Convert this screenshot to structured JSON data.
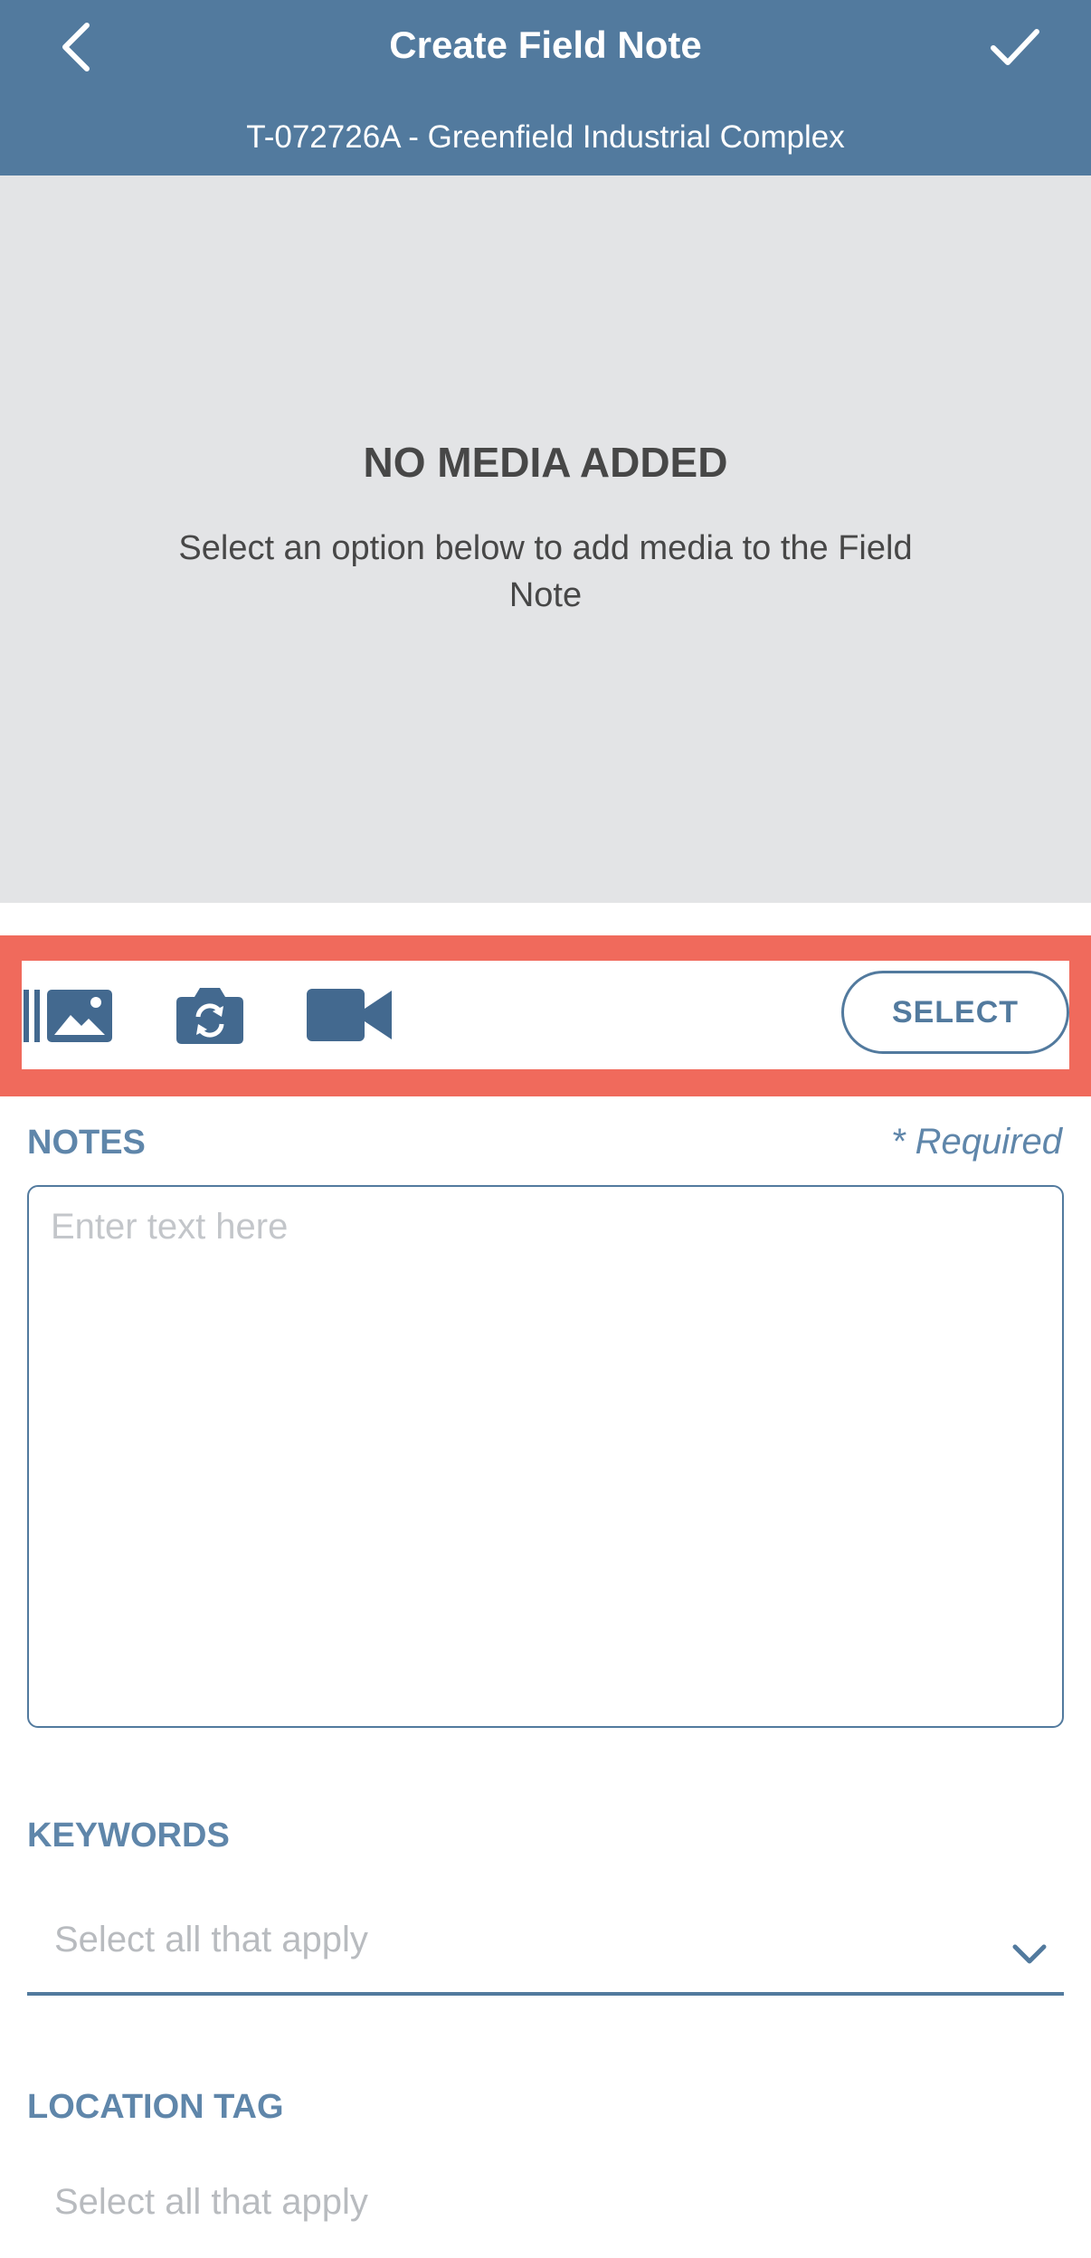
{
  "header": {
    "title": "Create Field Note",
    "subtitle": "T-072726A - Greenfield Industrial Complex",
    "back_icon": "chevron-left-icon",
    "confirm_icon": "checkmark-icon"
  },
  "media": {
    "empty_title": "NO MEDIA ADDED",
    "empty_description": "Select an option below to add media to the Field Note"
  },
  "toolbar": {
    "gallery_icon": "photo-gallery-icon",
    "camera_icon": "camera-switch-icon",
    "video_icon": "video-camera-icon",
    "select_label": "SELECT"
  },
  "notes": {
    "label": "NOTES",
    "required_label": "* Required",
    "placeholder": "Enter text here",
    "value": ""
  },
  "keywords": {
    "label": "KEYWORDS",
    "placeholder": "Select all that apply"
  },
  "location_tag": {
    "label": "LOCATION TAG",
    "placeholder": "Select all that apply"
  },
  "colors": {
    "header": "#527a9e",
    "accent": "#527a9e",
    "highlight": "#f06a5c",
    "media_bg": "#e3e4e6",
    "label": "#5f86aa"
  }
}
